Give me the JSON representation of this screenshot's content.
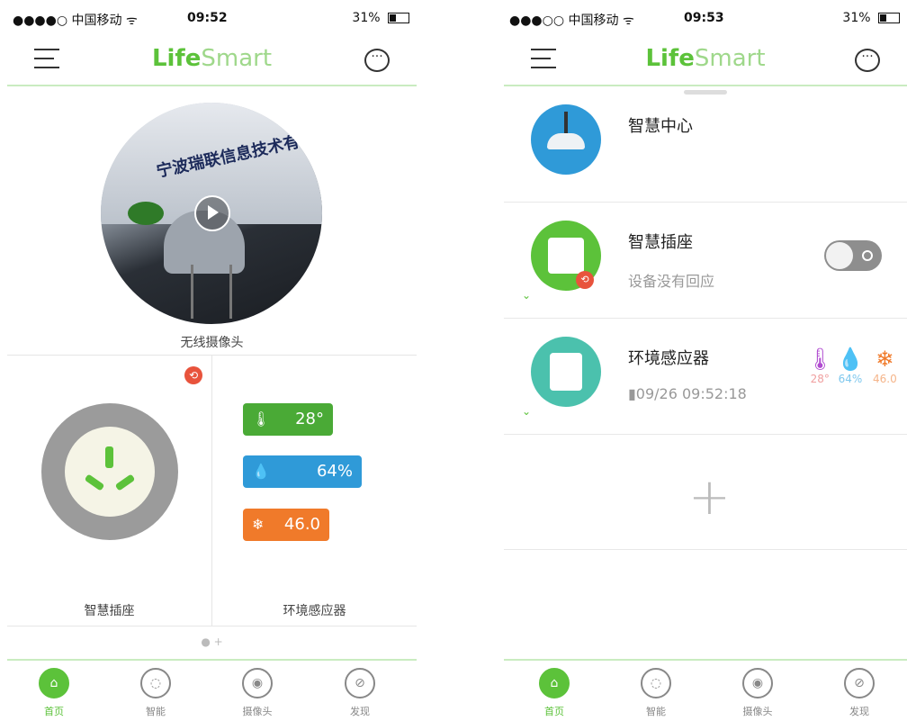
{
  "left": {
    "status": {
      "carrier": "●●●●○ 中国移动 ᯤ",
      "time": "09:52",
      "battery": "31%"
    },
    "app_logo": {
      "life": "Life",
      "smart": "Smart"
    },
    "camera_label": "无线摄像头",
    "camera_banner": "宁波瑞联信息技术有限",
    "socket_label": "智慧插座",
    "env_label": "环境感应器",
    "sensors": {
      "temperature": "28°",
      "humidity": "64%",
      "pm": "46.0"
    },
    "pager": "● +"
  },
  "right": {
    "status": {
      "carrier": "●●●○○ 中国移动 ᯤ",
      "time": "09:53",
      "battery": "31%"
    },
    "app_logo": {
      "life": "Life",
      "smart": "Smart"
    },
    "devices": [
      {
        "name": "智慧中心",
        "sub": ""
      },
      {
        "name": "智慧插座",
        "sub": "设备没有回应"
      },
      {
        "name": "环境感应器",
        "sub": "▮09/26 09:52:18"
      }
    ],
    "sensor_mini": {
      "temperature": "28°",
      "humidity": "64%",
      "pm": "46.0"
    },
    "add_label": "+"
  },
  "tabs": [
    {
      "label": "首页"
    },
    {
      "label": "智能"
    },
    {
      "label": "摄像头"
    },
    {
      "label": "发现"
    }
  ],
  "colors": {
    "brand_green": "#5cc23a",
    "temp_green": "#4aaa36",
    "hum_blue": "#2f9ad8",
    "pm_orange": "#f07a2a",
    "alert_red": "#e8533c"
  }
}
